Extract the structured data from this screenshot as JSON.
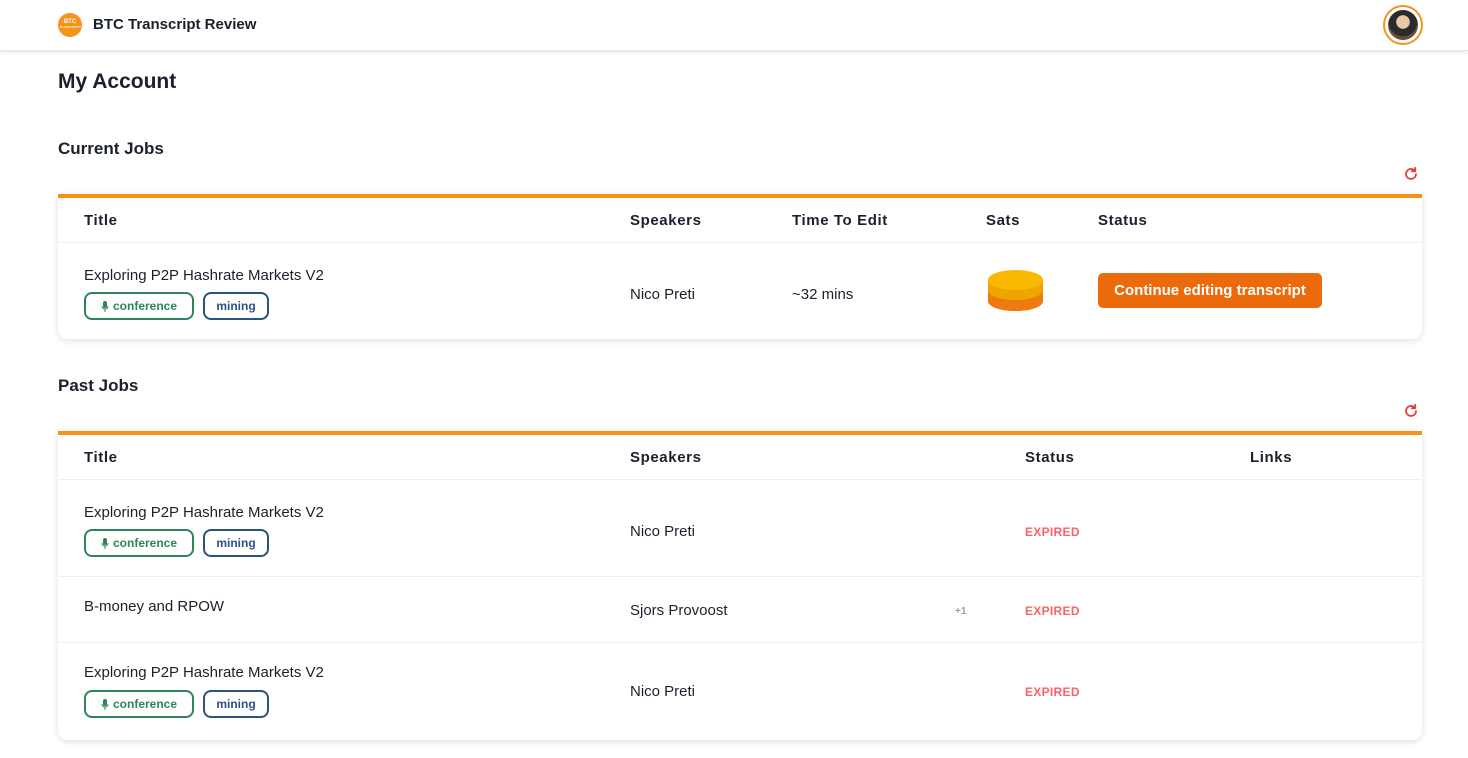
{
  "header": {
    "logo_text": "BTC",
    "logo_sub": "TRANSCRIPTS",
    "app_title": "BTC Transcript Review"
  },
  "page_title": "My Account",
  "current_jobs": {
    "heading": "Current Jobs",
    "columns": [
      "Title",
      "Speakers",
      "Time To Edit",
      "Sats",
      "Status"
    ],
    "rows": [
      {
        "title": "Exploring P2P Hashrate Markets V2",
        "tags": [
          "conference",
          "mining"
        ],
        "speakers": "Nico Preti",
        "time_to_edit": "~32 mins",
        "sats_icon": "coins-icon",
        "status_button": "Continue editing transcript"
      }
    ]
  },
  "past_jobs": {
    "heading": "Past Jobs",
    "columns": [
      "Title",
      "Speakers",
      "Status",
      "Links"
    ],
    "rows": [
      {
        "title": "Exploring P2P Hashrate Markets V2",
        "tags": [
          "conference",
          "mining"
        ],
        "speakers": "Nico Preti",
        "extra_speakers": "",
        "status": "EXPIRED"
      },
      {
        "title": "B-money and RPOW",
        "tags": [],
        "speakers": "Sjors Provoost",
        "extra_speakers": "+1",
        "status": "EXPIRED"
      },
      {
        "title": "Exploring P2P Hashrate Markets V2",
        "tags": [
          "conference",
          "mining"
        ],
        "speakers": "Nico Preti",
        "extra_speakers": "",
        "status": "EXPIRED"
      }
    ]
  },
  "colors": {
    "accent": "#f7931a",
    "button": "#eb6b0c",
    "expired": "#f56565",
    "conference_tag": "#2f855a",
    "mining_tag": "#2c5282",
    "refresh": "#e53e3e"
  }
}
